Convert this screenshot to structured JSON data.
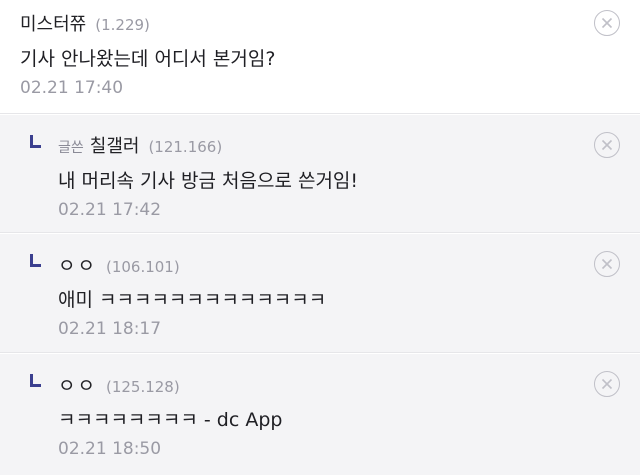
{
  "comments": [
    {
      "nick": "미스터쮸",
      "ip": "(1.229)",
      "text": "기사 안나왔는데 어디서 본거임?",
      "time": "02.21 17:40"
    },
    {
      "tag": "글쓴",
      "nick": "칠갤러",
      "ip": "(121.166)",
      "text": "내 머리속 기사 방금 처음으로 쓴거임!",
      "time": "02.21 17:42"
    },
    {
      "nick": "ㅇㅇ",
      "ip": "(106.101)",
      "text": "애미 ㅋㅋㅋㅋㅋㅋㅋㅋㅋㅋㅋㅋㅋ",
      "time": "02.21 18:17"
    },
    {
      "nick": "ㅇㅇ",
      "ip": "(125.128)",
      "text": "ㅋㅋㅋㅋㅋㅋㅋㅋ - dc App",
      "time": "02.21 18:50"
    }
  ],
  "icons": {
    "delete": "close-circle-icon",
    "reply": "reply-arrow-icon"
  },
  "colors": {
    "reply_background": "#f4f4f6",
    "reply_arrow": "#3b3f8f",
    "meta_text": "#9a9aa4"
  }
}
